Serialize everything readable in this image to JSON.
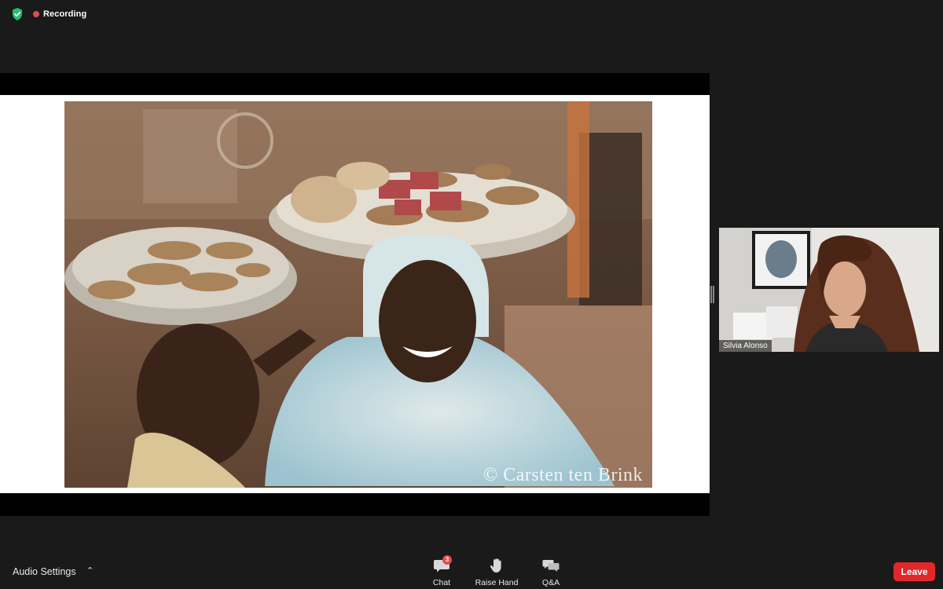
{
  "status": {
    "security_icon": "shield-check-icon",
    "security_color": "#1fc16b",
    "recording_label": "Recording",
    "recording_color": "#e5484d"
  },
  "share": {
    "watermark": "© Carsten ten Brink"
  },
  "participant": {
    "name": "Silvia Alonso"
  },
  "toolbar": {
    "audio_settings_label": "Audio Settings",
    "chat_label": "Chat",
    "chat_badge": "3",
    "raise_hand_label": "Raise Hand",
    "qa_label": "Q&A",
    "leave_label": "Leave",
    "leave_color": "#e02828"
  }
}
